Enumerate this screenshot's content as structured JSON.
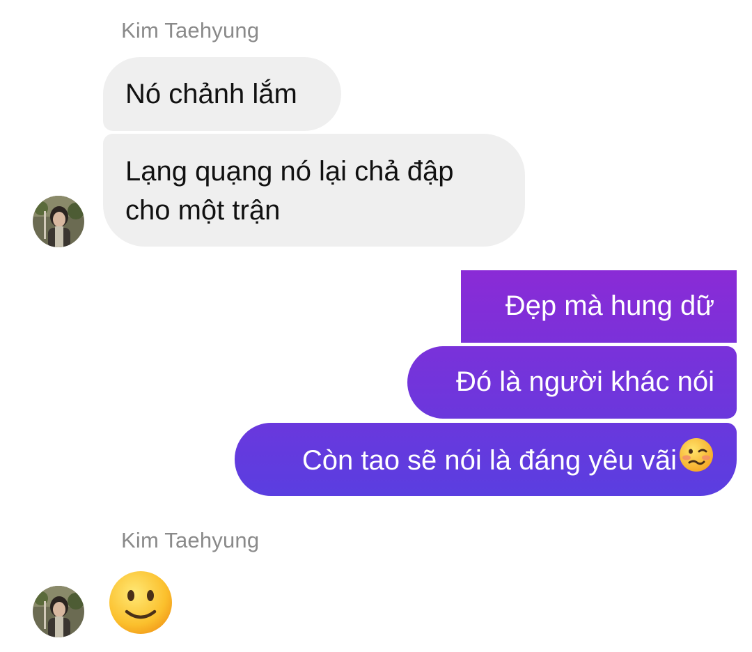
{
  "conversation": {
    "group1": {
      "sender_name": "Kim Taehyung",
      "messages": [
        {
          "text": "Nó chảnh lắm"
        },
        {
          "line1": "Lạng quạng nó lại chả đập",
          "line2": "cho một trận"
        }
      ]
    },
    "outgoing": {
      "messages": [
        {
          "text": "Đẹp mà hung dữ"
        },
        {
          "text": "Đó là người khác nói"
        },
        {
          "text": "Còn tao sẽ nói là đáng yêu vãi",
          "emoji": "woozy-face-icon"
        }
      ],
      "gradient_top": "#8a2bd6",
      "gradient_bottom": "#5a3ee0"
    },
    "group2": {
      "sender_name": "Kim Taehyung",
      "emoji": "slightly-smiling-face-icon"
    }
  },
  "colors": {
    "incoming_bubble": "#efefef",
    "sender_name": "#8a8a8a",
    "outgoing_text": "#ffffff"
  }
}
